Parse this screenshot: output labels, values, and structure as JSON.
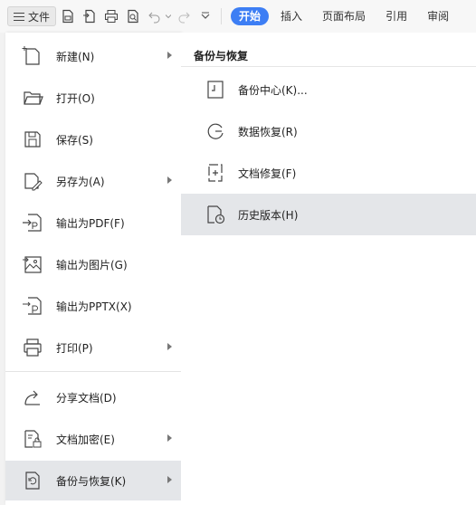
{
  "toolbar": {
    "file_label": "文件",
    "tabs": [
      "开始",
      "插入",
      "页面布局",
      "引用",
      "审阅"
    ],
    "active_tab": "开始",
    "accent_color": "#3d7ef4"
  },
  "menu": {
    "items": [
      {
        "label": "新建(N)",
        "icon": "new-file-icon",
        "has_submenu": true
      },
      {
        "label": "打开(O)",
        "icon": "folder-open-icon",
        "has_submenu": false
      },
      {
        "label": "保存(S)",
        "icon": "save-icon",
        "has_submenu": false
      },
      {
        "label": "另存为(A)",
        "icon": "save-as-icon",
        "has_submenu": true
      },
      {
        "label": "输出为PDF(F)",
        "icon": "export-pdf-icon",
        "has_submenu": false
      },
      {
        "label": "输出为图片(G)",
        "icon": "export-image-icon",
        "has_submenu": false
      },
      {
        "label": "输出为PPTX(X)",
        "icon": "export-pptx-icon",
        "has_submenu": false
      },
      {
        "label": "打印(P)",
        "icon": "print-icon",
        "has_submenu": true
      },
      {
        "label": "分享文档(D)",
        "icon": "share-icon",
        "has_submenu": false
      },
      {
        "label": "文档加密(E)",
        "icon": "encrypt-icon",
        "has_submenu": true
      },
      {
        "label": "备份与恢复(K)",
        "icon": "backup-icon",
        "has_submenu": true,
        "selected": true
      }
    ]
  },
  "submenu": {
    "title": "备份与恢复",
    "items": [
      {
        "label": "备份中心(K)...",
        "icon": "backup-center-icon"
      },
      {
        "label": "数据恢复(R)",
        "icon": "data-recovery-icon"
      },
      {
        "label": "文档修复(F)",
        "icon": "doc-repair-icon"
      },
      {
        "label": "历史版本(H)",
        "icon": "history-version-icon",
        "selected": true
      }
    ]
  }
}
